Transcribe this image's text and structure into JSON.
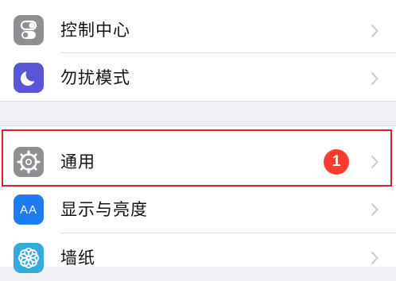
{
  "settings": {
    "group1": [
      {
        "label": "控制中心",
        "icon": "control-center-icon",
        "color": "#8e8e93"
      },
      {
        "label": "勿扰模式",
        "icon": "moon-icon",
        "color": "#5856d6"
      }
    ],
    "group2": [
      {
        "label": "通用",
        "icon": "gear-icon",
        "color": "#8e8e93",
        "badge": "1"
      },
      {
        "label": "显示与亮度",
        "icon": "display-brightness-icon",
        "color": "#1e7cf2",
        "icon_text": "AA"
      },
      {
        "label": "墙纸",
        "icon": "wallpaper-icon",
        "color": "#35aadc"
      }
    ]
  },
  "highlight_color": "#d8232e"
}
